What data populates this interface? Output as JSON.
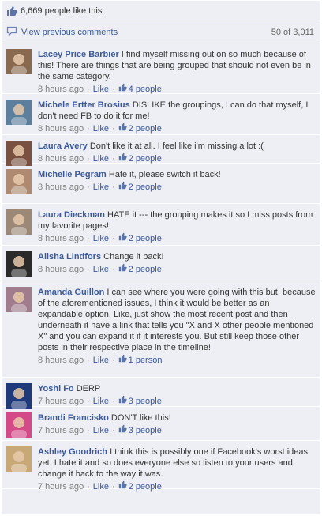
{
  "likes_summary": "6,669 people like this.",
  "view_previous": {
    "label": "View previous comments",
    "count": "50 of 3,011"
  },
  "like_label": "Like",
  "comments": [
    {
      "author": "Lacey Price Barbier",
      "text": "I find myself missing out on so much because of this! There are things that are being grouped that should not even be in the same category.",
      "time": "8 hours ago",
      "likes": "4 people",
      "avatar_color": "#8a6a4f"
    },
    {
      "author": "Michele Ertter Brosius",
      "text": "DISLIKE the groupings, I can do that myself, I don't need FB to do it for me!",
      "time": "8 hours ago",
      "likes": "2 people",
      "avatar_color": "#5b7f9c"
    },
    {
      "author": "Laura Avery",
      "text": "Don't like it at all. I feel like i'm missing a lot :(",
      "time": "8 hours ago",
      "likes": "2 people",
      "avatar_color": "#7a5040"
    },
    {
      "author": "Michelle Pegram",
      "text": "Hate it, please switch it back!",
      "time": "8 hours ago",
      "likes": "2 people",
      "avatar_color": "#b08a70"
    },
    {
      "author": "Laura Dieckman",
      "text": "HATE it --- the grouping makes it so I miss posts from my favorite pages!",
      "time": "8 hours ago",
      "likes": "2 people",
      "avatar_color": "#9c8877"
    },
    {
      "author": "Alisha Lindfors",
      "text": "Change it back!",
      "time": "8 hours ago",
      "likes": "2 people",
      "avatar_color": "#2a2a2a"
    },
    {
      "author": "Amanda Guillon",
      "text": "I can see where you were going with this but, because of the aforementioned issues, I think it would be better as an expandable option. Like, just show the most recent post and then underneath it have a link that tells you \"X and X other people mentioned X\" and you can expand it if it interests you. But still keep those other posts in their respective place in the timeline!",
      "time": "8 hours ago",
      "likes": "1 person",
      "avatar_color": "#a07c8c"
    },
    {
      "author": "Yoshi Fo",
      "text": "DERP",
      "time": "7 hours ago",
      "likes": "3 people",
      "avatar_color": "#1e3a7a"
    },
    {
      "author": "Brandi Francisko",
      "text": "DON'T like this!",
      "time": "7 hours ago",
      "likes": "3 people",
      "avatar_color": "#d44a88"
    },
    {
      "author": "Ashley Goodrich",
      "text": "I think this is possibly one if Facebook's worst ideas yet. I hate it and so does everyone else so listen to your users and change it back to the way it was.",
      "time": "7 hours ago",
      "likes": "2 people",
      "avatar_color": "#c9a878"
    }
  ],
  "colors": {
    "link": "#3b5998",
    "background": "#edeff4",
    "meta": "#808080"
  },
  "icons": {
    "likes": "thumbs-up-icon",
    "comments": "speech-bubble-icon",
    "comment_like": "thumbs-up-icon"
  }
}
